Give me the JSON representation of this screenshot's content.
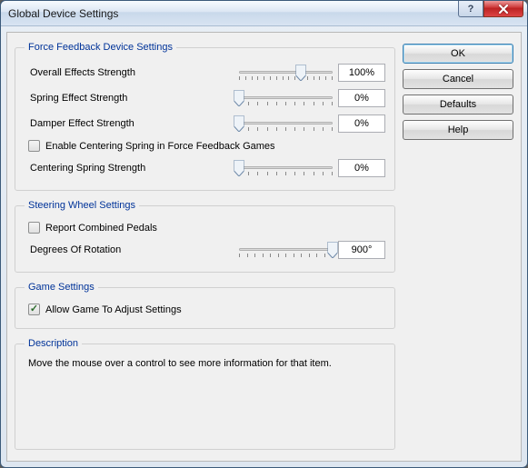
{
  "window": {
    "title": "Global Device Settings"
  },
  "buttons": {
    "ok": "OK",
    "cancel": "Cancel",
    "defaults": "Defaults",
    "help": "Help"
  },
  "ffb": {
    "legend": "Force Feedback Device Settings",
    "overall": {
      "label": "Overall Effects Strength",
      "value": "100%",
      "pos": 66
    },
    "spring": {
      "label": "Spring Effect Strength",
      "value": "0%",
      "pos": 0
    },
    "damper": {
      "label": "Damper Effect Strength",
      "value": "0%",
      "pos": 0
    },
    "centering_checkbox": "Enable Centering Spring in Force Feedback Games",
    "centering_checked": false,
    "centering": {
      "label": "Centering Spring Strength",
      "value": "0%",
      "pos": 0
    }
  },
  "steering": {
    "legend": "Steering Wheel Settings",
    "combined_label": "Report Combined Pedals",
    "combined_checked": false,
    "rotation": {
      "label": "Degrees Of Rotation",
      "value": "900°",
      "pos": 100
    }
  },
  "game": {
    "legend": "Game Settings",
    "allow_label": "Allow Game To Adjust Settings",
    "allow_checked": true
  },
  "description": {
    "legend": "Description",
    "text": "Move the mouse over a control to see more information for that item."
  }
}
